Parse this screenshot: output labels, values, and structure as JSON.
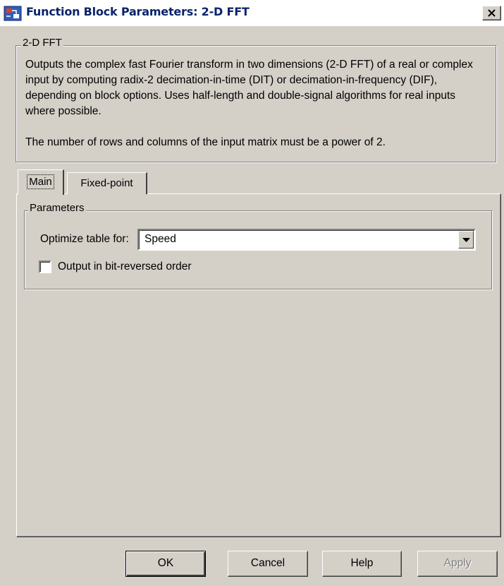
{
  "window": {
    "title": "Function Block Parameters: 2-D FFT"
  },
  "block": {
    "name": "2-D FFT",
    "description_1": "Outputs the complex fast Fourier transform in two dimensions (2-D FFT) of a real or complex input by computing radix-2 decimation-in-time (DIT) or decimation-in-frequency (DIF), depending on block options. Uses half-length and double-signal algorithms for real inputs where possible.",
    "description_2": "The number of rows and columns of the input matrix must be a power of 2."
  },
  "tabs": [
    {
      "label": "Main",
      "active": true
    },
    {
      "label": "Fixed-point",
      "active": false
    }
  ],
  "parameters": {
    "group_label": "Parameters",
    "optimize_label": "Optimize table for:",
    "optimize_value": "Speed",
    "bitreversed_label": "Output in bit-reversed order",
    "bitreversed_checked": false
  },
  "buttons": {
    "ok": "OK",
    "cancel": "Cancel",
    "help": "Help",
    "apply": "Apply"
  },
  "colors": {
    "dialog_face": "#d4d0c8",
    "title_text": "#0a246a",
    "disabled_text": "#808080"
  }
}
